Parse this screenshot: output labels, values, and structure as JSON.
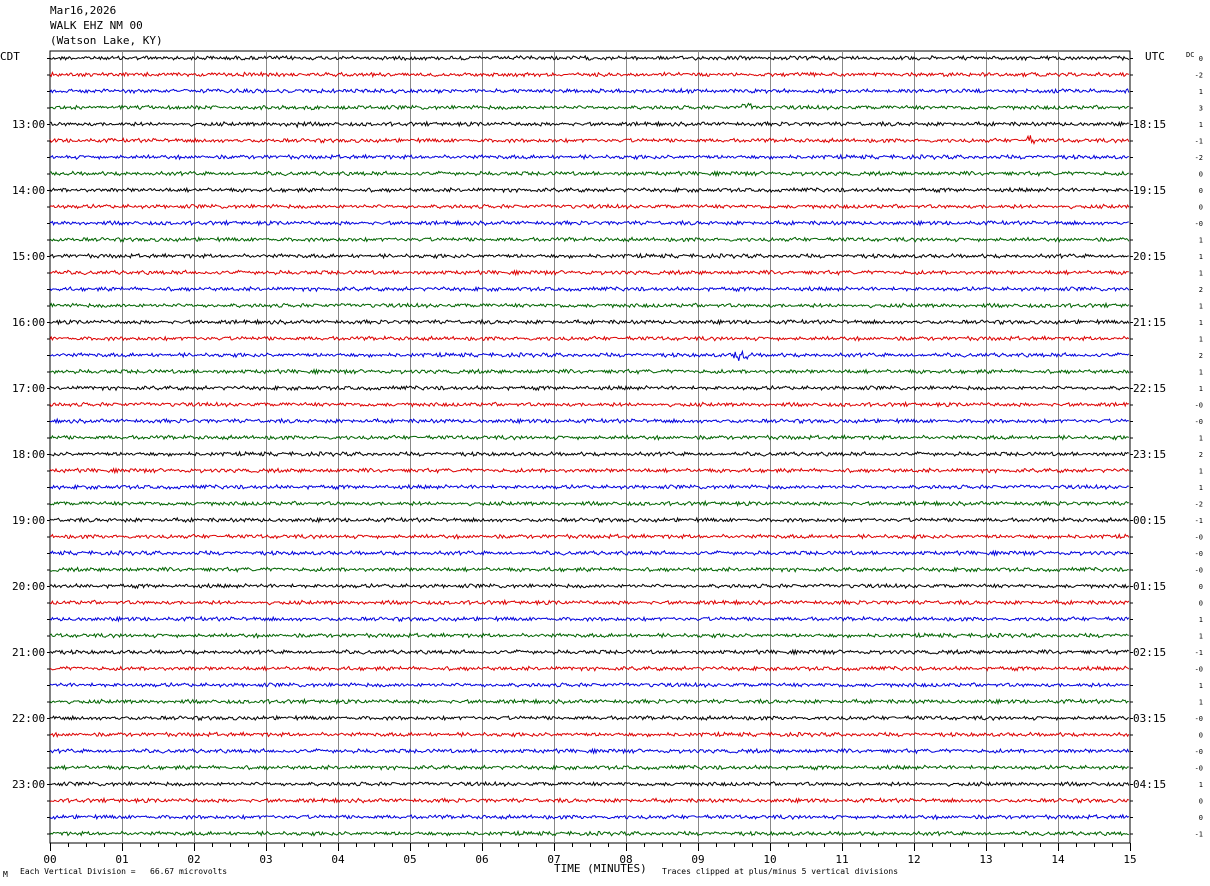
{
  "header": {
    "date": "Mar16,2026",
    "station": "WALK EHZ NM 00",
    "location": "(Watson Lake, KY)"
  },
  "left_axis_label": "CDT",
  "right_axis_label": "UTC",
  "dc_label": "DC",
  "footer": {
    "scale_text": "Each Vertical Division =   66.67 microvolts",
    "scale_marker": "M",
    "clip_text": "Traces clipped at plus/minus 5 vertical divisions"
  },
  "chart_data": {
    "type": "line",
    "title": "WALK EHZ NM 00 (Watson Lake, KY) Mar16,2026",
    "xlabel": "TIME (MINUTES)",
    "ylabel": "",
    "xlim": [
      0,
      15
    ],
    "x_ticks": [
      "00",
      "01",
      "02",
      "03",
      "04",
      "05",
      "06",
      "07",
      "08",
      "09",
      "10",
      "11",
      "12",
      "13",
      "14",
      "15"
    ],
    "traces_per_hour": 4,
    "trace_minutes": 15,
    "trace_colors": [
      "#000000",
      "#dd0000",
      "#0000dd",
      "#006400"
    ],
    "left_hour_labels": [
      {
        "trace": 4,
        "label": "13:00"
      },
      {
        "trace": 8,
        "label": "14:00"
      },
      {
        "trace": 12,
        "label": "15:00"
      },
      {
        "trace": 16,
        "label": "16:00"
      },
      {
        "trace": 20,
        "label": "17:00"
      },
      {
        "trace": 24,
        "label": "18:00"
      },
      {
        "trace": 28,
        "label": "19:00"
      },
      {
        "trace": 32,
        "label": "20:00"
      },
      {
        "trace": 36,
        "label": "21:00"
      },
      {
        "trace": 40,
        "label": "22:00"
      },
      {
        "trace": 44,
        "label": "23:00"
      }
    ],
    "right_hour_labels": [
      {
        "trace": 4,
        "label": "18:15"
      },
      {
        "trace": 8,
        "label": "19:15"
      },
      {
        "trace": 12,
        "label": "20:15"
      },
      {
        "trace": 16,
        "label": "21:15"
      },
      {
        "trace": 20,
        "label": "22:15"
      },
      {
        "trace": 24,
        "label": "23:15"
      },
      {
        "trace": 28,
        "label": "00:15"
      },
      {
        "trace": 32,
        "label": "01:15"
      },
      {
        "trace": 36,
        "label": "02:15"
      },
      {
        "trace": 40,
        "label": "03:15"
      },
      {
        "trace": 44,
        "label": "04:15"
      }
    ],
    "dc_offsets": [
      "0",
      "-2",
      "1",
      "3",
      "1",
      "-1",
      "-2",
      "0",
      "0",
      "0",
      "-0",
      "1",
      "1",
      "1",
      "2",
      "1",
      "1",
      "1",
      "2",
      "1",
      "1",
      "-0",
      "-0",
      "1",
      "2",
      "1",
      "1",
      "-2",
      "-1",
      "-0",
      "-0",
      "-0",
      "0",
      "0",
      "1",
      "1",
      "-1",
      "-0",
      "1",
      "1",
      "-0",
      "0",
      "-0",
      "-0",
      "1",
      "0",
      "0",
      "-1"
    ],
    "events": [
      {
        "trace": 5,
        "minute": 13.6,
        "amplitude": 2.0
      },
      {
        "trace": 18,
        "minute": 9.6,
        "amplitude": 3.5
      },
      {
        "trace": 4,
        "minute": 3.4,
        "amplitude": 1.6
      },
      {
        "trace": 3,
        "minute": 9.7,
        "amplitude": 1.6
      }
    ]
  }
}
